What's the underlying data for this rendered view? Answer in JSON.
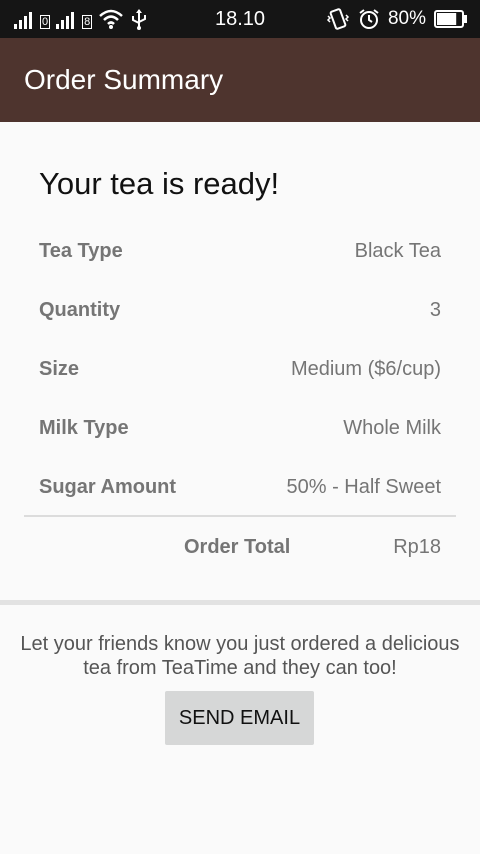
{
  "status_bar": {
    "time": "18.10",
    "sim1_label": "0",
    "sim2_label": "8",
    "battery_percent": "80%",
    "battery_level": 0.8,
    "icons": [
      "signal-icon",
      "signal-icon",
      "wifi-icon",
      "usb-icon",
      "vibrate-icon",
      "alarm-icon",
      "battery-icon"
    ]
  },
  "app_bar": {
    "title": "Order Summary"
  },
  "summary": {
    "headline": "Your tea is ready!",
    "rows": [
      {
        "label": "Tea Type",
        "value": "Black Tea"
      },
      {
        "label": "Quantity",
        "value": "3"
      },
      {
        "label": "Size",
        "value": "Medium ($6/cup)"
      },
      {
        "label": "Milk Type",
        "value": "Whole Milk"
      },
      {
        "label": "Sugar Amount",
        "value": "50% - Half Sweet"
      }
    ],
    "total_label": "Order Total",
    "total_value": "Rp18"
  },
  "share": {
    "message": "Let your friends know you just ordered a delicious tea from TeaTime and they can too!",
    "button_label": "SEND EMAIL"
  }
}
